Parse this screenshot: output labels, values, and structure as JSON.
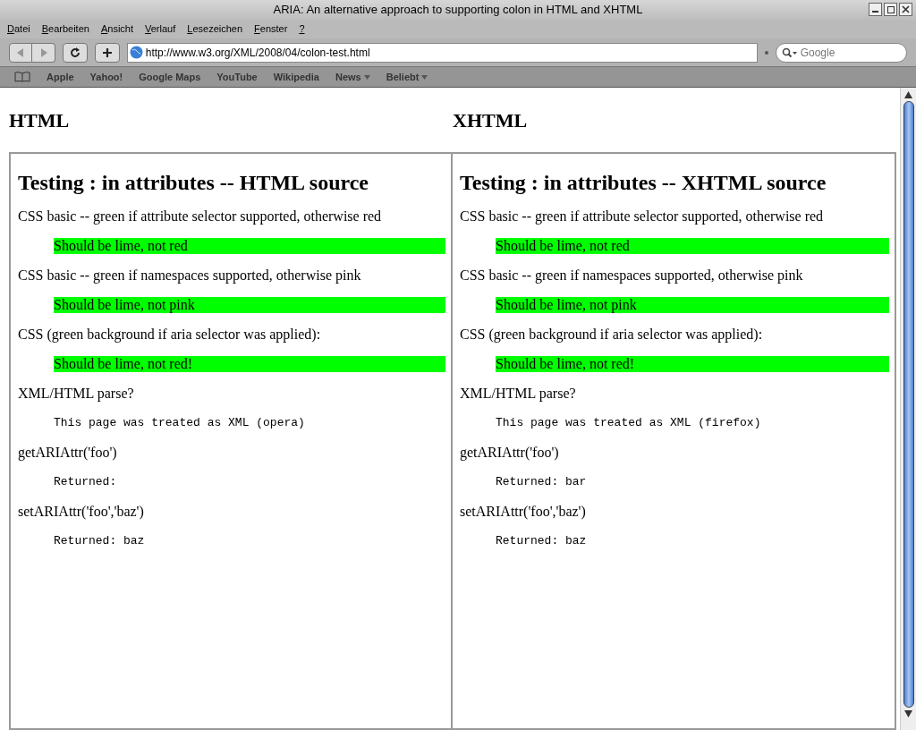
{
  "window": {
    "title": "ARIA: An alternative approach to supporting colon in HTML and XHTML"
  },
  "menu": [
    {
      "label": "Datei"
    },
    {
      "label": "Bearbeiten"
    },
    {
      "label": "Ansicht"
    },
    {
      "label": "Verlauf"
    },
    {
      "label": "Lesezeichen"
    },
    {
      "label": "Fenster"
    },
    {
      "label": "?"
    }
  ],
  "address": {
    "value": "http://www.w3.org/XML/2008/04/colon-test.html"
  },
  "search": {
    "placeholder": "Google"
  },
  "bookmarks": [
    {
      "label": "Apple",
      "dropdown": false
    },
    {
      "label": "Yahoo!",
      "dropdown": false
    },
    {
      "label": "Google Maps",
      "dropdown": false
    },
    {
      "label": "YouTube",
      "dropdown": false
    },
    {
      "label": "Wikipedia",
      "dropdown": false
    },
    {
      "label": "News",
      "dropdown": true
    },
    {
      "label": "Beliebt",
      "dropdown": true
    }
  ],
  "columns": [
    {
      "heading": "HTML",
      "frame_heading": "Testing : in attributes -- HTML source",
      "blocks": [
        {
          "kind": "text",
          "text": "CSS basic -- green if attribute selector supported, otherwise red"
        },
        {
          "kind": "result",
          "text": "Should be lime, not red",
          "color": "#00ff00"
        },
        {
          "kind": "text",
          "text": "CSS basic -- green if namespaces supported, otherwise pink"
        },
        {
          "kind": "result",
          "text": "Should be lime, not pink",
          "color": "#00ff00"
        },
        {
          "kind": "text",
          "text": "CSS (green background if aria selector was applied):"
        },
        {
          "kind": "result",
          "text": "Should be lime, not red!",
          "color": "#00ff00"
        },
        {
          "kind": "text",
          "text": "XML/HTML parse?"
        },
        {
          "kind": "code",
          "text": "This page was treated as XML (opera)"
        },
        {
          "kind": "text",
          "text": "getARIAttr('foo')"
        },
        {
          "kind": "code",
          "text": "Returned:"
        },
        {
          "kind": "text",
          "text": "setARIAttr('foo','baz')"
        },
        {
          "kind": "code",
          "text": "Returned: baz"
        }
      ]
    },
    {
      "heading": "XHTML",
      "frame_heading": "Testing : in attributes -- XHTML source",
      "blocks": [
        {
          "kind": "text",
          "text": "CSS basic -- green if attribute selector supported, otherwise red"
        },
        {
          "kind": "result",
          "text": "Should be lime, not red",
          "color": "#00ff00"
        },
        {
          "kind": "text",
          "text": "CSS basic -- green if namespaces supported, otherwise pink"
        },
        {
          "kind": "result",
          "text": "Should be lime, not pink",
          "color": "#00ff00"
        },
        {
          "kind": "text",
          "text": "CSS (green background if aria selector was applied):"
        },
        {
          "kind": "result",
          "text": "Should be lime, not red!",
          "color": "#00ff00"
        },
        {
          "kind": "text",
          "text": "XML/HTML parse?"
        },
        {
          "kind": "code",
          "text": "This page was treated as XML (firefox)"
        },
        {
          "kind": "text",
          "text": "getARIAttr('foo')"
        },
        {
          "kind": "code",
          "text": "Returned: bar"
        },
        {
          "kind": "text",
          "text": "setARIAttr('foo','baz')"
        },
        {
          "kind": "code",
          "text": "Returned: baz"
        }
      ]
    }
  ]
}
